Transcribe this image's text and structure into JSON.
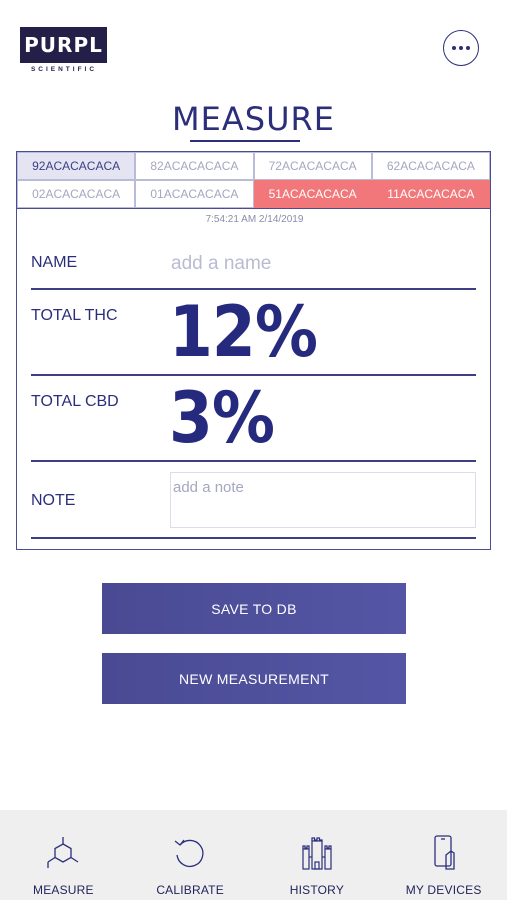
{
  "header": {
    "logo_text": "PURPL",
    "logo_subtext": "SCIENTIFIC",
    "more_label": "more options"
  },
  "page_title": "MEASURE",
  "devices": [
    {
      "id": "92ACACACACA",
      "state": "selected"
    },
    {
      "id": "82ACACACACA",
      "state": "normal"
    },
    {
      "id": "72ACACACACA",
      "state": "normal"
    },
    {
      "id": "62ACACACACA",
      "state": "normal"
    },
    {
      "id": "02ACACACACA",
      "state": "normal"
    },
    {
      "id": "01ACACACACA",
      "state": "normal"
    },
    {
      "id": "51ACACACACA",
      "state": "alert"
    },
    {
      "id": "11ACACACACA",
      "state": "alert"
    }
  ],
  "measurement": {
    "timestamp": "7:54:21 AM 2/14/2019",
    "name_label": "NAME",
    "name_placeholder": "add a name",
    "thc_label": "TOTAL THC",
    "thc_value": "12%",
    "cbd_label": "TOTAL CBD",
    "cbd_value": "3%",
    "note_label": "NOTE",
    "note_placeholder": "add a note"
  },
  "actions": {
    "save_label": "SAVE TO DB",
    "new_label": "NEW MEASUREMENT"
  },
  "nav": [
    {
      "label": "MEASURE",
      "icon": "molecule-icon"
    },
    {
      "label": "CALIBRATE",
      "icon": "refresh-icon"
    },
    {
      "label": "HISTORY",
      "icon": "castle-icon"
    },
    {
      "label": "MY DEVICES",
      "icon": "phone-hand-icon"
    }
  ],
  "colors": {
    "primary": "#2b2f7a",
    "button": "#4f50a0",
    "alert": "#f2777a",
    "selected": "#e4e4f3",
    "nav_bg": "#efefef"
  }
}
